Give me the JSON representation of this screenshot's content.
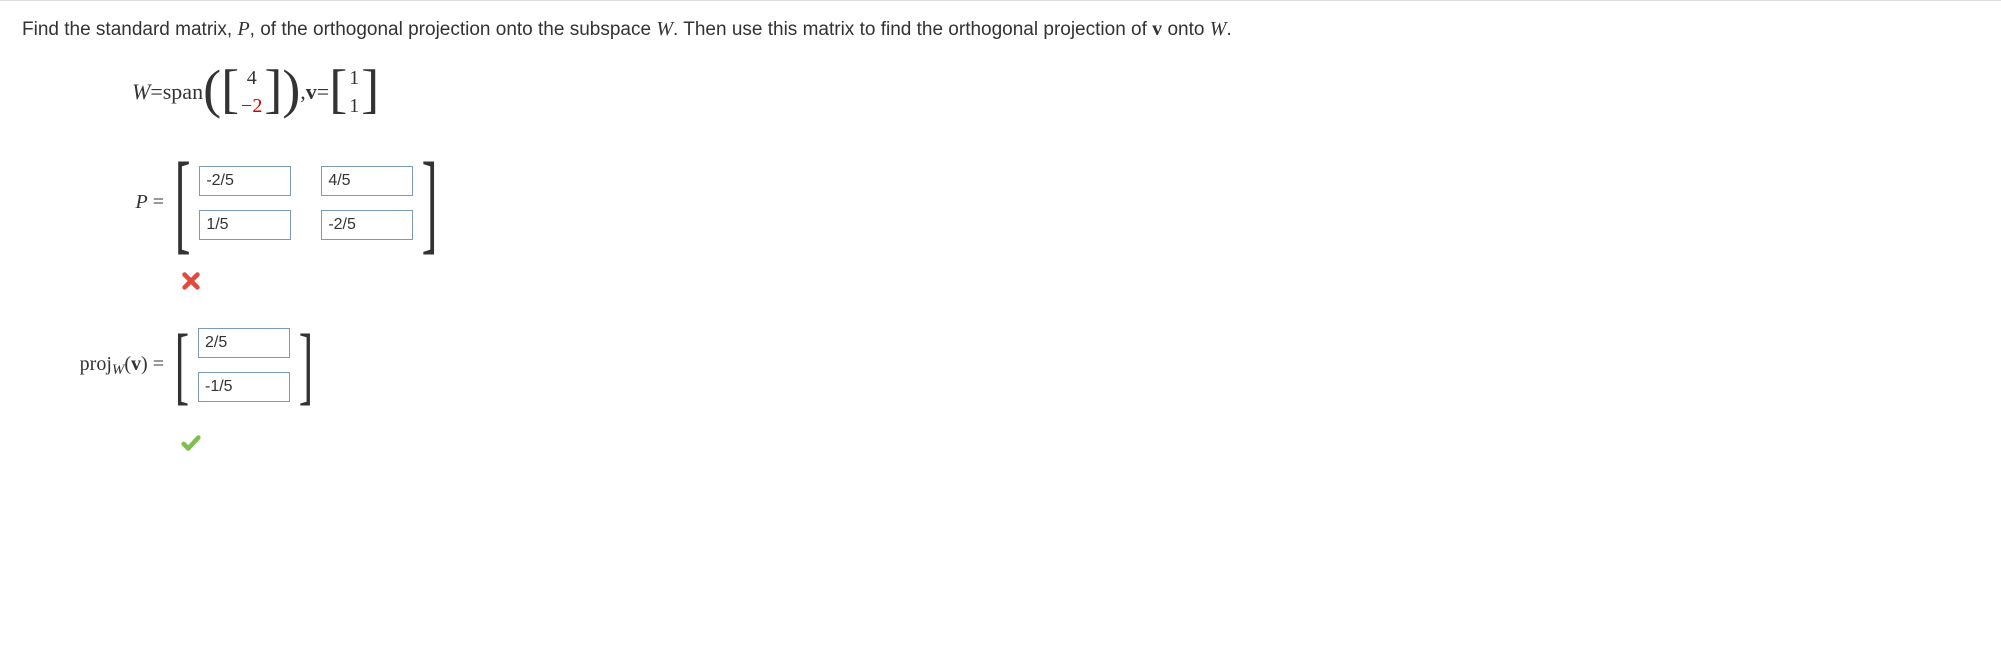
{
  "prompt": {
    "pre": "Find the standard matrix, ",
    "P": "P",
    "mid1": ", of the orthogonal projection onto the subspace ",
    "W": "W",
    "mid2": ". Then use this matrix to find the orthogonal projection of ",
    "v": "v",
    "mid3": " onto ",
    "W2": "W",
    "end": "."
  },
  "given": {
    "W_label": "W",
    "equals": " = ",
    "span": "span",
    "vecW_top": "4",
    "vecW_bot": "−2",
    "comma": ", ",
    "v_label": "v",
    "vecV_top": "1",
    "vecV_bot": "1"
  },
  "P_answer": {
    "label_P": "P",
    "equals": " = ",
    "cells": {
      "r1c1": "-2/5",
      "r1c2": "4/5",
      "r2c1": "1/5",
      "r2c2": "-2/5"
    }
  },
  "proj_answer": {
    "label_pre": "proj",
    "label_sub": "W",
    "label_arg_open": "(",
    "label_arg_v": "v",
    "label_arg_close": ")",
    "equals": " = ",
    "cells": {
      "r1": "2/5",
      "r2": "-1/5"
    }
  }
}
